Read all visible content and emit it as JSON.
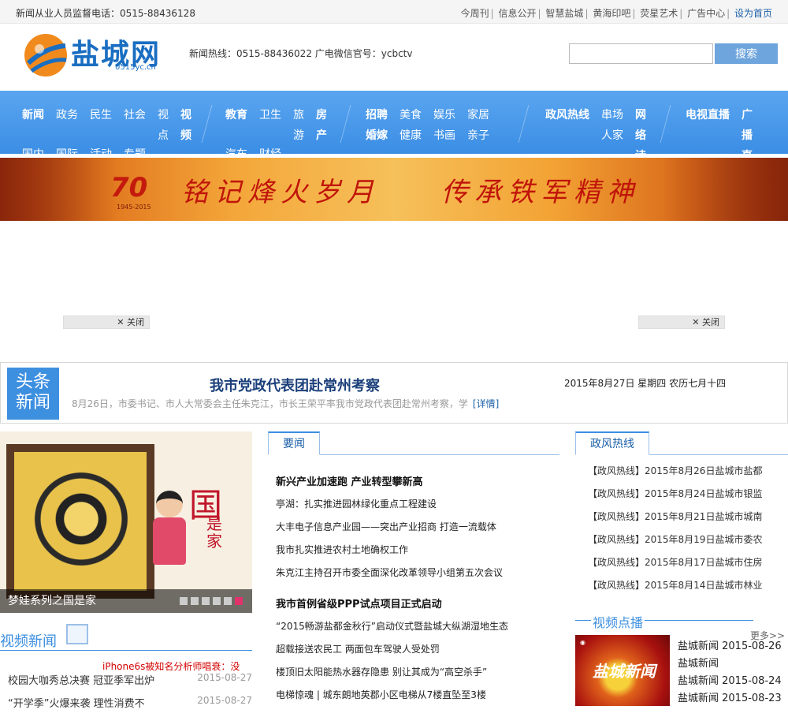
{
  "topbar": {
    "hotline": "新闻从业人员监督电话：0515-88436128",
    "links": [
      "今周刊",
      "信息公开",
      "智慧盐城",
      "黄海印吧",
      "荧星艺术",
      "广告中心"
    ],
    "home_link": "设为首页"
  },
  "header": {
    "logo_text": "盐城网",
    "logo_sub": "0515yc.cn",
    "info": "新闻热线：0515-88436022 广电微信官号：ycbctv",
    "search": {
      "placeholder": "",
      "button": "搜索"
    }
  },
  "nav": {
    "row1_g1": [
      "新闻",
      "政务",
      "民生",
      "社会"
    ],
    "row2_g1": [
      "国内",
      "国际",
      "活动",
      "专题"
    ],
    "g1b_col1": [
      "视",
      "点"
    ],
    "g1b_col2": [
      "视",
      "频"
    ],
    "row1_g2": [
      "教育",
      "卫生"
    ],
    "row2_g2": [
      "汽车",
      "财经"
    ],
    "g2b_col1": [
      "旅",
      "游"
    ],
    "g2b_col2": [
      "房",
      "产"
    ],
    "row1_g3": [
      "招聘",
      "美食",
      "娱乐",
      "家居"
    ],
    "row2_g3": [
      "婚嫁",
      "健康",
      "书画",
      "亲子"
    ],
    "g4_hot": "政风热线",
    "g4_col2": [
      "串场",
      "人家"
    ],
    "g4_col3": [
      "网",
      "络",
      "诗"
    ],
    "g5_live": "电视直播",
    "g5_col2": [
      "广",
      "播",
      "直"
    ]
  },
  "banner": {
    "badge": "70",
    "badge_years": "1945-2015",
    "slogan1": "铭记烽火岁月",
    "slogan2": "传承铁军精神"
  },
  "ad_close_label": "关闭",
  "headline": {
    "tag_line1": "头条",
    "tag_line2": "新闻",
    "title": "我市党政代表团赴常州考察",
    "summary": "8月26日，市委书记、市人大常委会主任朱克江，市长王荣平率我市党政代表团赴常州考察，学",
    "more": "[详情]",
    "date": "2015年8月27日 星期四 农历七月十四"
  },
  "feature": {
    "guo": "国",
    "shijia": "是家",
    "caption": "梦娃系列之国是家"
  },
  "video_news": {
    "title": "视频新闻",
    "red_item": "iPhone6s被知名分析师唱衰：没",
    "items": [
      {
        "title": "校园大咖秀总决赛 冠亚季军出炉",
        "date": "2015-08-27"
      },
      {
        "title": "“开学季”火爆来袭 理性消费不",
        "date": "2015-08-27"
      }
    ]
  },
  "yaowen": {
    "tab": "要闻",
    "lead1": "新兴产业加速跑 产业转型攀新高",
    "items1": [
      "亭湖：扎实推进园林绿化重点工程建设",
      "大丰电子信息产业园——突出产业招商 打造一流载体",
      "我市扎实推进农村土地确权工作",
      "朱克江主持召开市委全面深化改革领导小组第五次会议"
    ],
    "lead2": "我市首例省级PPP试点项目正式启动",
    "items2": [
      "“2015畅游盐都金秋行”启动仪式暨盐城大纵湖湿地生态",
      "超载接送农民工 两面包车驾驶人受处罚",
      "楼顶旧太阳能热水器存隐患 别让其成为“高空杀手”",
      "电梯惊魂 | 城东朗地英郡小区电梯从7楼直坠至3楼"
    ]
  },
  "hotline": {
    "tab": "政风热线",
    "items": [
      "【政风热线】2015年8月26日盐城市盐都",
      "【政风热线】2015年8月24日盐城市银监",
      "【政风热线】2015年8月21日盐城市城南",
      "【政风热线】2015年8月19日盐城市委农",
      "【政风热线】2015年8月17日盐城市住房",
      "【政风热线】2015年8月14日盐城市林业"
    ]
  },
  "video_point": {
    "title": "视频点播",
    "more": "更多>>",
    "thumb_label": "盐城新闻",
    "items": [
      "盐城新闻 2015-08-26",
      "盐城新闻",
      "盐城新闻 2015-08-24",
      "盐城新闻 2015-08-23"
    ]
  },
  "colors": {
    "accent": "#3d8fe0",
    "nav": "#4a9aea",
    "brand": "#1a6ec2",
    "alert": "#d40000"
  }
}
